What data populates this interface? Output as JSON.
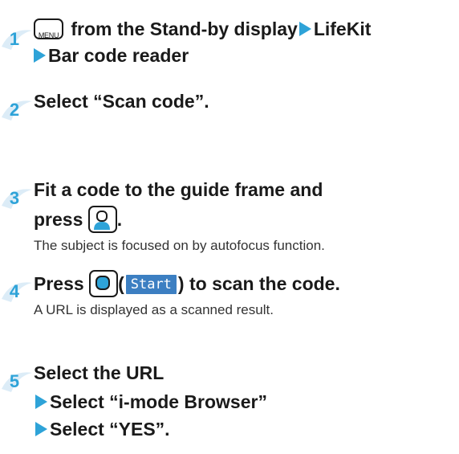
{
  "steps": [
    {
      "number": "1",
      "key_label": "MENU",
      "line1_text": " from the Stand-by display",
      "line1_target": "LifeKit",
      "line2_text": "Bar code reader"
    },
    {
      "number": "2",
      "line1_text": "Select “Scan code”."
    },
    {
      "number": "3",
      "line1_text": "Fit a code to the guide frame and",
      "line2_text": "press ",
      "line2_end": ".",
      "note": "The subject is focused on by autofocus function."
    },
    {
      "number": "4",
      "line1_prefix": "Press ",
      "paren_open": "(",
      "softkey_label": "Start",
      "line1_suffix": ") to scan the code.",
      "note": "A URL is displayed as a scanned result."
    },
    {
      "number": "5",
      "line1_text": "Select the URL",
      "line2_text": "Select “i-mode Browser”",
      "line3_text": "Select “YES”."
    }
  ],
  "colors": {
    "accent": "#2ea3d8",
    "softkey_bg": "#3c7fc2",
    "badge_bg": "#dcecf7"
  }
}
